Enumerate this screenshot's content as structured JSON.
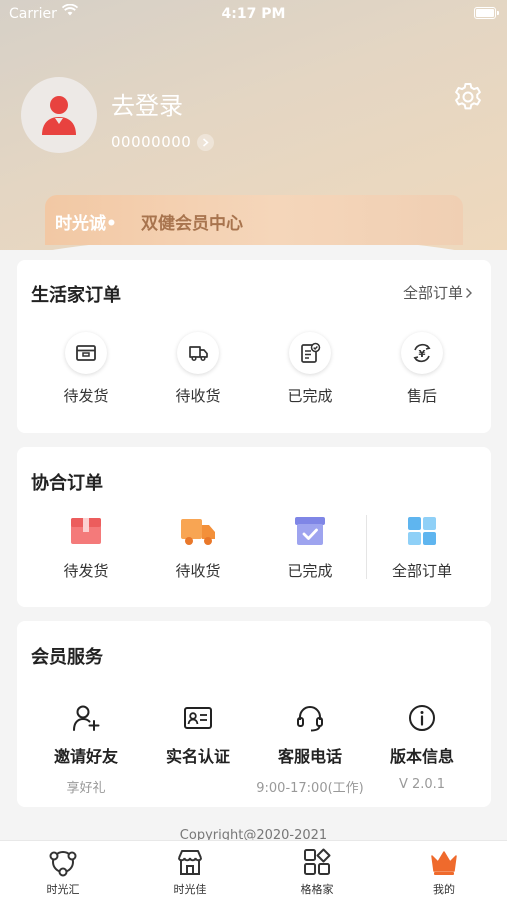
{
  "status": {
    "carrier": "Carrier",
    "time": "4:17 PM"
  },
  "profile": {
    "login": "去登录",
    "uid": "00000000"
  },
  "member": {
    "brand": "时光诚•",
    "text": "双健会员中心"
  },
  "life_orders": {
    "title": "生活家订单",
    "all": "全部订单",
    "items": [
      {
        "label": "待发货",
        "icon": "box-icon"
      },
      {
        "label": "待收货",
        "icon": "truck-icon"
      },
      {
        "label": "已完成",
        "icon": "checklist-icon"
      },
      {
        "label": "售后",
        "icon": "yuan-refresh-icon"
      }
    ]
  },
  "coop_orders": {
    "title": "协合订单",
    "items": [
      {
        "label": "待发货",
        "icon": "red-package-icon"
      },
      {
        "label": "待收货",
        "icon": "orange-truck-icon"
      },
      {
        "label": "已完成",
        "icon": "purple-done-box-icon"
      },
      {
        "label": "全部订单",
        "icon": "blue-grid-icon"
      }
    ]
  },
  "services": {
    "title": "会员服务",
    "items": [
      {
        "title": "邀请好友",
        "sub": "享好礼",
        "icon": "add-user-icon"
      },
      {
        "title": "实名认证",
        "sub": "",
        "icon": "id-card-icon"
      },
      {
        "title": "客服电话",
        "sub": "9:00-17:00(工作)",
        "icon": "headset-icon"
      },
      {
        "title": "版本信息",
        "sub": "V 2.0.1",
        "icon": "info-icon"
      }
    ]
  },
  "copyright": "Copyright@2020-2021",
  "tabbar": {
    "items": [
      {
        "label": "时光汇",
        "icon": "circle-nodes-icon"
      },
      {
        "label": "时光佳",
        "icon": "store-icon"
      },
      {
        "label": "格格家",
        "icon": "grid-apps-icon"
      },
      {
        "label": "我的",
        "icon": "crown-icon",
        "active": true
      }
    ],
    "accent": "#ef6a2c"
  }
}
